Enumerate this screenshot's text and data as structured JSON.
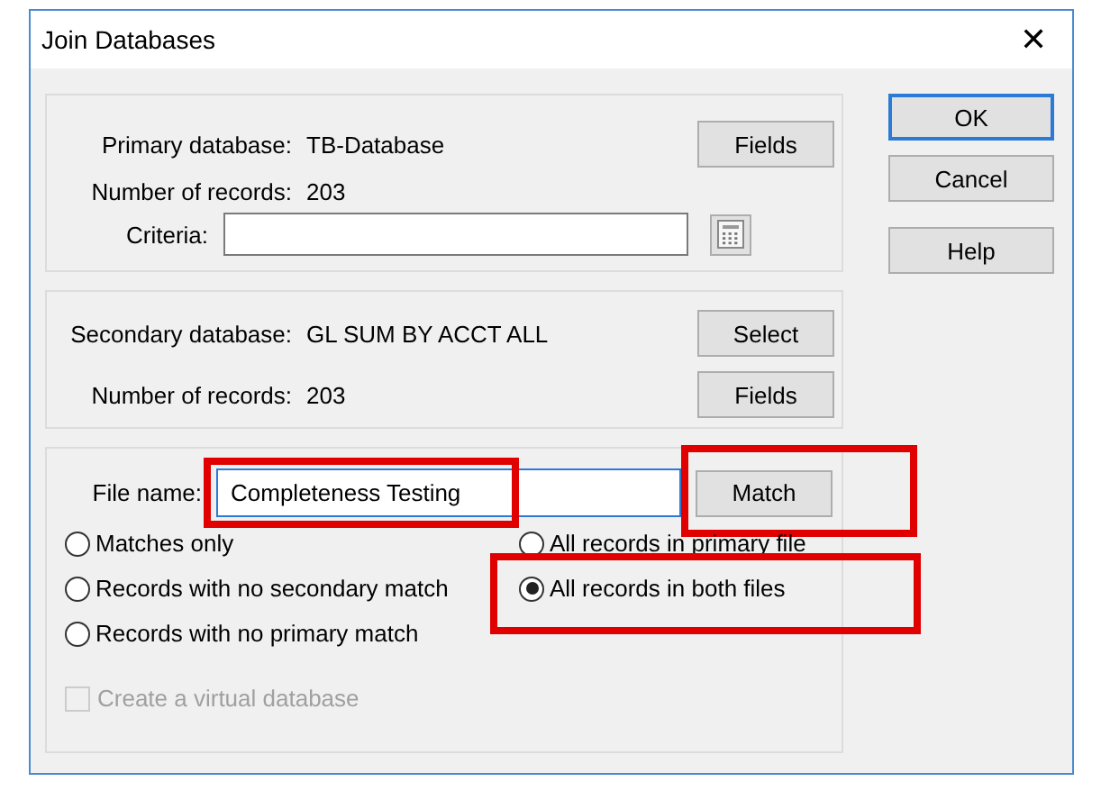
{
  "window": {
    "title": "Join Databases",
    "close": "✕"
  },
  "primary": {
    "label": "Primary database:",
    "value": "TB-Database",
    "records_label": "Number of records:",
    "records": "203",
    "fields_button": "Fields",
    "criteria_label": "Criteria:"
  },
  "secondary": {
    "label": "Secondary database:",
    "value": "GL SUM BY ACCT ALL",
    "records_label": "Number of records:",
    "records": "203",
    "select_button": "Select",
    "fields_button": "Fields"
  },
  "output": {
    "file_label": "File name:",
    "file_value": "Completeness Testing",
    "file_highlighted": true,
    "match_button": "Match",
    "match_highlighted": true,
    "options": [
      {
        "label": "Matches only",
        "selected": false,
        "highlighted": false
      },
      {
        "label": "All records in primary file",
        "selected": false,
        "highlighted": false
      },
      {
        "label": "Records with no secondary match",
        "selected": false,
        "highlighted": false
      },
      {
        "label": "All records in both files",
        "selected": true,
        "highlighted": true
      },
      {
        "label": "Records with no primary match",
        "selected": false,
        "highlighted": false
      }
    ],
    "virtual": {
      "label": "Create a virtual database",
      "checked": false,
      "disabled": true
    }
  },
  "buttons": [
    {
      "label": "OK",
      "default": true
    },
    {
      "label": "Cancel",
      "default": false
    },
    {
      "label": "Help",
      "default": false
    }
  ]
}
